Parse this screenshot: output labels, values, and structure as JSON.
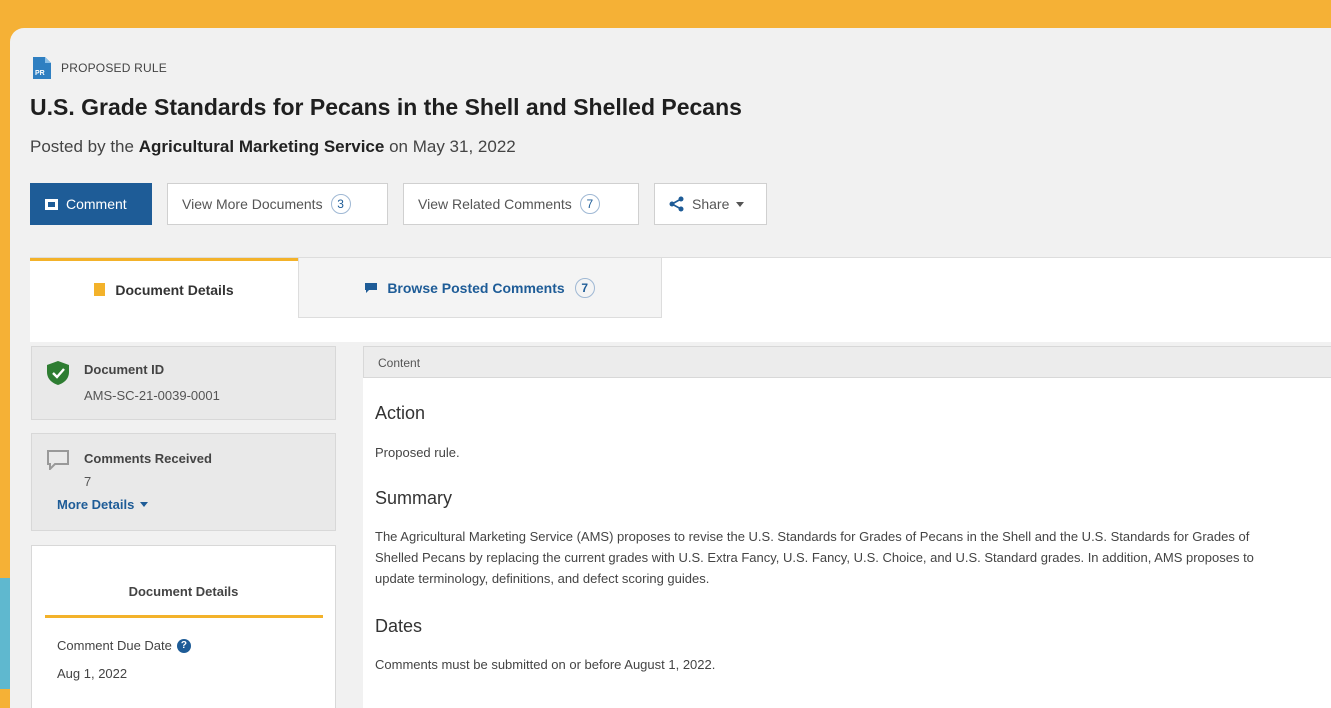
{
  "document": {
    "type_label": "PROPOSED RULE",
    "type_icon_text": "PR",
    "title": "U.S. Grade Standards for Pecans in the Shell and Shelled Pecans",
    "posted_prefix": "Posted by the",
    "agency": "Agricultural Marketing Service",
    "posted_suffix": "on May 31, 2022"
  },
  "actions": {
    "comment_label": "Comment",
    "view_more_label": "View More Documents",
    "view_more_count": "3",
    "related_comments_label": "View Related Comments",
    "related_comments_count": "7",
    "share_label": "Share"
  },
  "tabs": {
    "details_label": "Document Details",
    "comments_label": "Browse Posted Comments",
    "comments_count": "7"
  },
  "sidebar": {
    "document_id_label": "Document ID",
    "document_id": "AMS-SC-21-0039-0001",
    "comments_received_label": "Comments Received",
    "comments_received": "7",
    "more_details_label": "More Details",
    "details_heading": "Document Details",
    "due_date_label": "Comment Due Date",
    "due_date": "Aug 1, 2022"
  },
  "content": {
    "header_label": "Content",
    "action_heading": "Action",
    "action_text": "Proposed rule.",
    "summary_heading": "Summary",
    "summary_text": "The Agricultural Marketing Service (AMS) proposes to revise the U.S. Standards for Grades of Pecans in the Shell and the U.S. Standards for Grades of Shelled Pecans by replacing the current grades with U.S. Extra Fancy, U.S. Fancy, U.S. Choice, and U.S. Standard grades. In addition, AMS proposes to update terminology, definitions, and defect scoring guides.",
    "dates_heading": "Dates",
    "dates_text": "Comments must be submitted on or before August 1, 2022."
  },
  "colors": {
    "background": "#f5b136",
    "accent_strip": "#5fb8cf",
    "primary": "#1e5c97",
    "tab_highlight": "#f3b22a",
    "verified": "#2e7d32"
  },
  "icons": [
    "document-pr-icon",
    "comment-icon",
    "share-icon",
    "bookmark-icon",
    "comments-icon",
    "shield-check-icon",
    "speech-bubble-icon",
    "help-icon",
    "caret-down-icon"
  ]
}
